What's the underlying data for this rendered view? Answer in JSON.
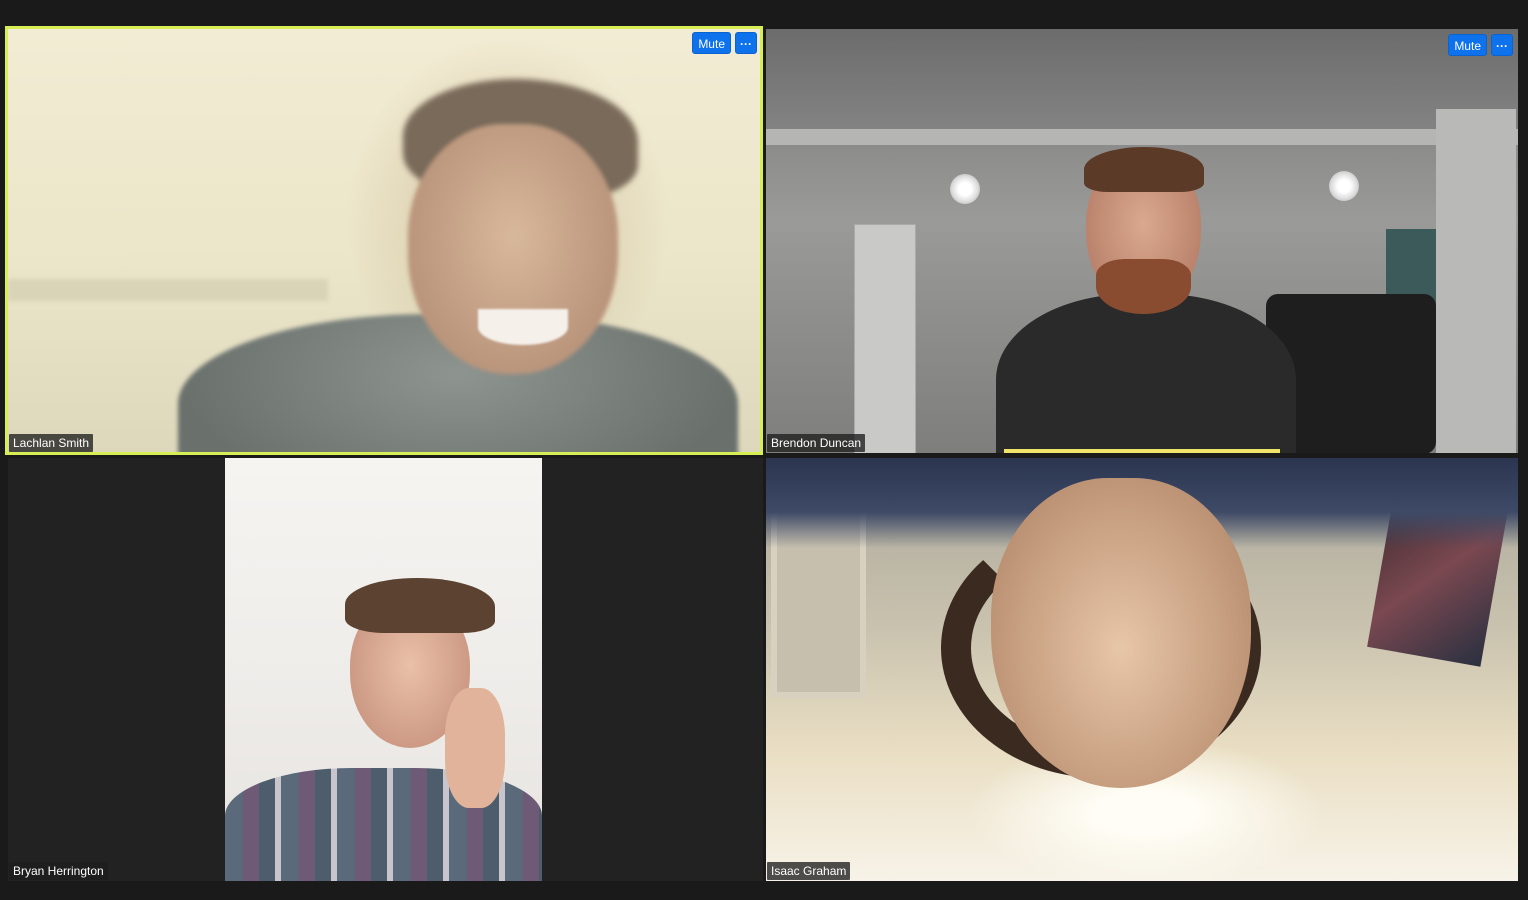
{
  "participants": [
    {
      "name": "Lachlan Smith",
      "active_speaker": true,
      "controls": {
        "mute_label": "Mute",
        "more_label": "···"
      }
    },
    {
      "name": "Brendon Duncan",
      "active_speaker": false,
      "controls": {
        "mute_label": "Mute",
        "more_label": "···"
      }
    },
    {
      "name": "Bryan Herrington",
      "active_speaker": false
    },
    {
      "name": "Isaac Graham",
      "active_speaker": false
    }
  ],
  "colors": {
    "background": "#1a1a1a",
    "active_speaker_border": "#d7ef55",
    "button_blue": "#0e72ed",
    "name_label_bg": "#1e1e1e"
  },
  "icons": {
    "more": "ellipsis-icon"
  }
}
